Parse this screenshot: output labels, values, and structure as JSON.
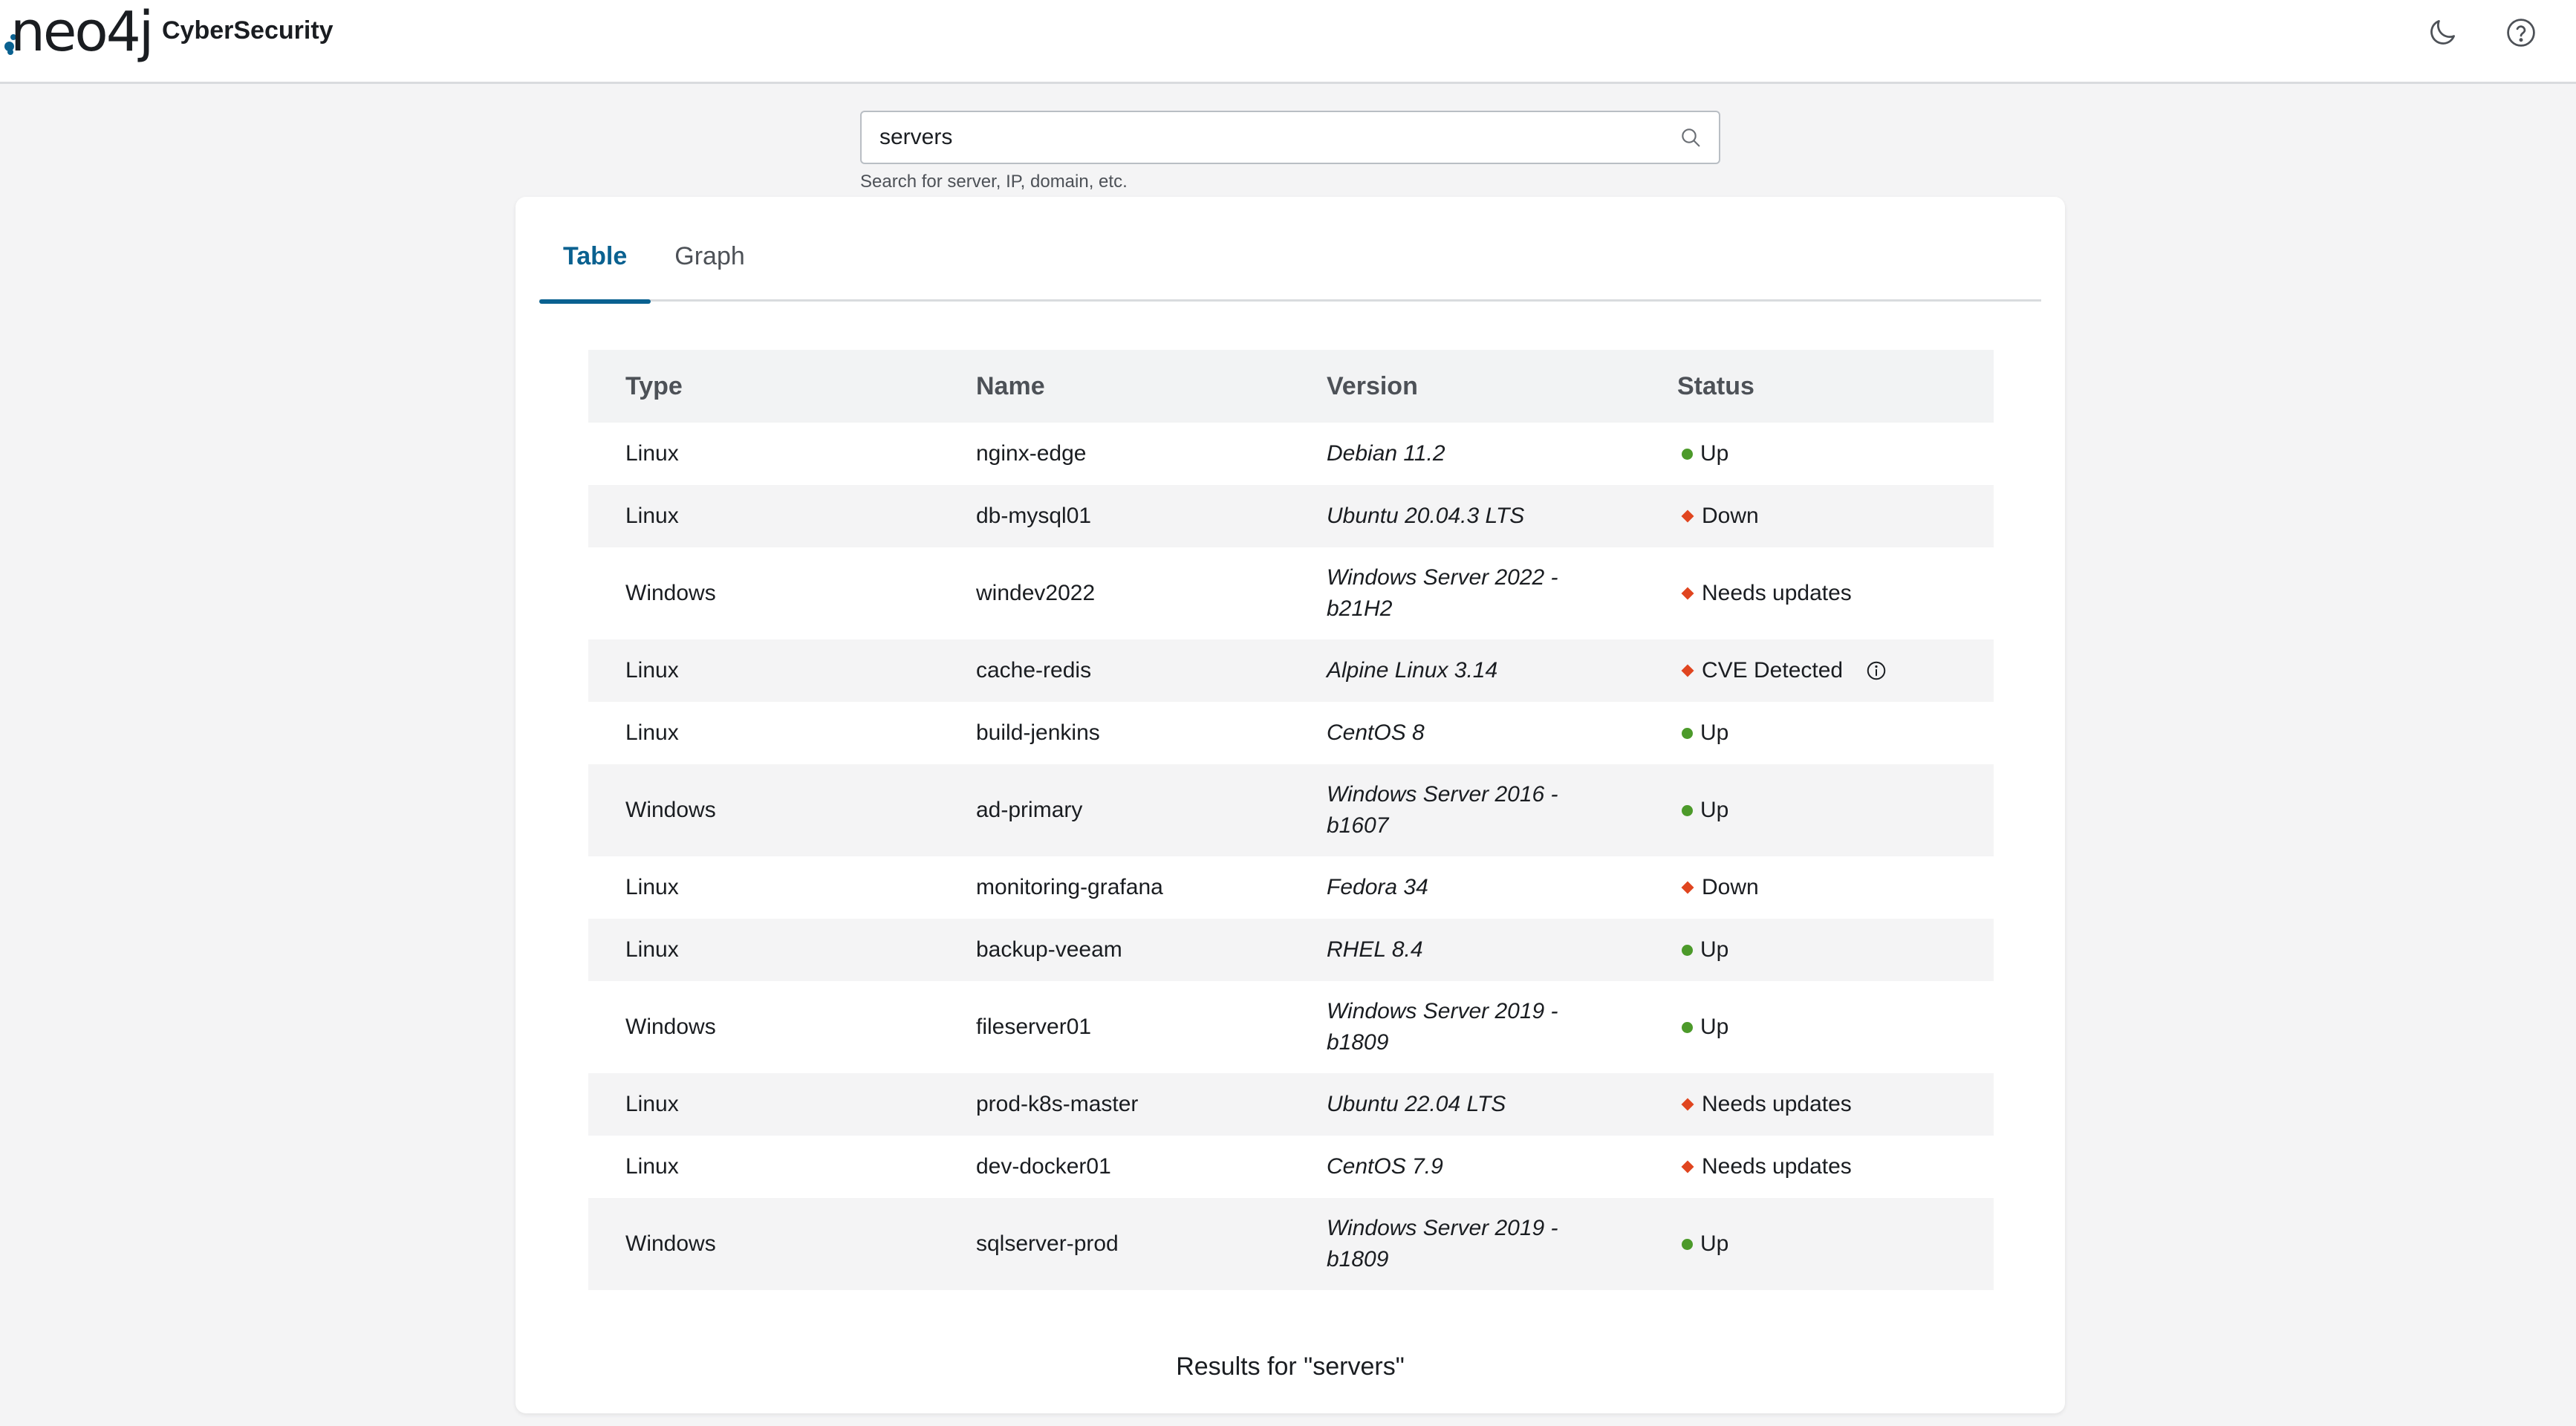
{
  "header": {
    "logo_text": "neo4j",
    "app_name": "CyberSecurity",
    "icons": {
      "theme": "moon-icon",
      "help": "help-icon"
    }
  },
  "search": {
    "value": "servers",
    "placeholder": "",
    "help_text": "Search for server, IP, domain, etc."
  },
  "tabs": [
    {
      "label": "Table",
      "active": true
    },
    {
      "label": "Graph",
      "active": false
    }
  ],
  "table": {
    "columns": [
      "Type",
      "Name",
      "Version",
      "Status"
    ],
    "rows": [
      {
        "type": "Linux",
        "name": "nginx-edge",
        "version": "Debian 11.2",
        "status": "Up",
        "status_kind": "ok"
      },
      {
        "type": "Linux",
        "name": "db-mysql01",
        "version": "Ubuntu 20.04.3 LTS",
        "status": "Down",
        "status_kind": "warn"
      },
      {
        "type": "Windows",
        "name": "windev2022",
        "version": "Windows Server 2022 - b21H2",
        "status": "Needs updates",
        "status_kind": "warn"
      },
      {
        "type": "Linux",
        "name": "cache-redis",
        "version": "Alpine Linux 3.14",
        "status": "CVE Detected",
        "status_kind": "warn",
        "info_icon": true
      },
      {
        "type": "Linux",
        "name": "build-jenkins",
        "version": "CentOS 8",
        "status": "Up",
        "status_kind": "ok"
      },
      {
        "type": "Windows",
        "name": "ad-primary",
        "version": "Windows Server 2016 - b1607",
        "status": "Up",
        "status_kind": "ok"
      },
      {
        "type": "Linux",
        "name": "monitoring-grafana",
        "version": "Fedora 34",
        "status": "Down",
        "status_kind": "warn"
      },
      {
        "type": "Linux",
        "name": "backup-veeam",
        "version": "RHEL 8.4",
        "status": "Up",
        "status_kind": "ok"
      },
      {
        "type": "Windows",
        "name": "fileserver01",
        "version": "Windows Server 2019 - b1809",
        "status": "Up",
        "status_kind": "ok"
      },
      {
        "type": "Linux",
        "name": "prod-k8s-master",
        "version": "Ubuntu 22.04 LTS",
        "status": "Needs updates",
        "status_kind": "warn"
      },
      {
        "type": "Linux",
        "name": "dev-docker01",
        "version": "CentOS 7.9",
        "status": "Needs updates",
        "status_kind": "warn"
      },
      {
        "type": "Windows",
        "name": "sqlserver-prod",
        "version": "Windows Server 2019 - b1809",
        "status": "Up",
        "status_kind": "ok"
      }
    ]
  },
  "results_text": "Results for \"servers\"",
  "colors": {
    "accent": "#0a6190",
    "status_ok": "#4c9a2a",
    "status_warn": "#e0451f"
  }
}
